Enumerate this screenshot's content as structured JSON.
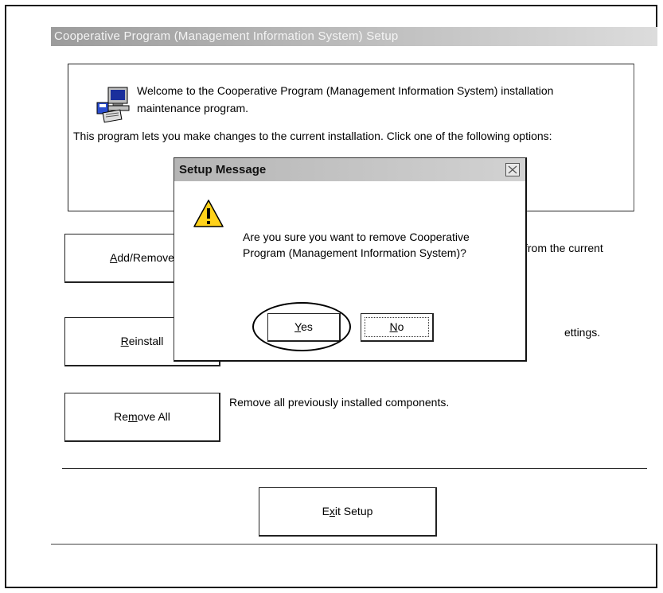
{
  "window": {
    "title": "Cooperative Program (Management Information System) Setup"
  },
  "welcome": {
    "text": "Welcome to the Cooperative Program (Management Information System) installation maintenance program.",
    "intro": "This program lets you make changes to the current installation. Click one of the following options:",
    "icon": "computer-setup-icon"
  },
  "options": {
    "add_remove": {
      "label": "Add/Remove",
      "mnemonic": "A",
      "description": "from the current"
    },
    "reinstall": {
      "label": "Reinstall",
      "mnemonic": "R",
      "description": "ettings."
    },
    "remove_all": {
      "label": "Remove All",
      "mnemonic": "m",
      "description": "Remove all previously installed components."
    }
  },
  "exit": {
    "label": "Exit Setup",
    "mnemonic": "x"
  },
  "dialog": {
    "title": "Setup Message",
    "message": "Are you sure you want to remove Cooperative Program (Management Information System)?",
    "icon": "warning-icon",
    "yes_label": "Yes",
    "no_label": "No",
    "close_icon": "close-icon"
  }
}
